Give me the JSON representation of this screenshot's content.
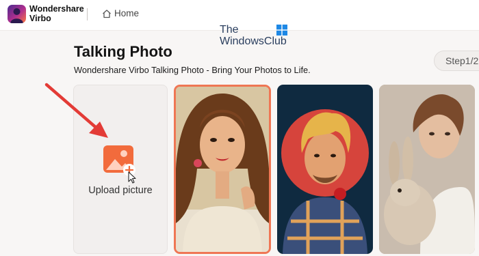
{
  "app": {
    "brand_line1": "Wondershare",
    "brand_line2": "Virbo",
    "logo_icon": "virbo-logo-icon"
  },
  "nav": {
    "home_label": "Home",
    "home_icon": "home-icon"
  },
  "watermark": {
    "line1": "The",
    "line2": "WindowsClub"
  },
  "page": {
    "title": "Talking Photo",
    "subtitle": "Wondershare Virbo Talking Photo - Bring Your Photos to Life.",
    "step": "Step1/2"
  },
  "upload": {
    "label": "Upload picture",
    "icon": "image-add-icon"
  },
  "photos": [
    {
      "name": "vintage-woman-portrait",
      "selected": true
    },
    {
      "name": "man-with-rose-portrait",
      "selected": false
    },
    {
      "name": "boy-with-rabbit-portrait",
      "selected": false
    }
  ],
  "colors": {
    "accent": "#ef7654",
    "annotation_arrow": "#e33b36"
  }
}
